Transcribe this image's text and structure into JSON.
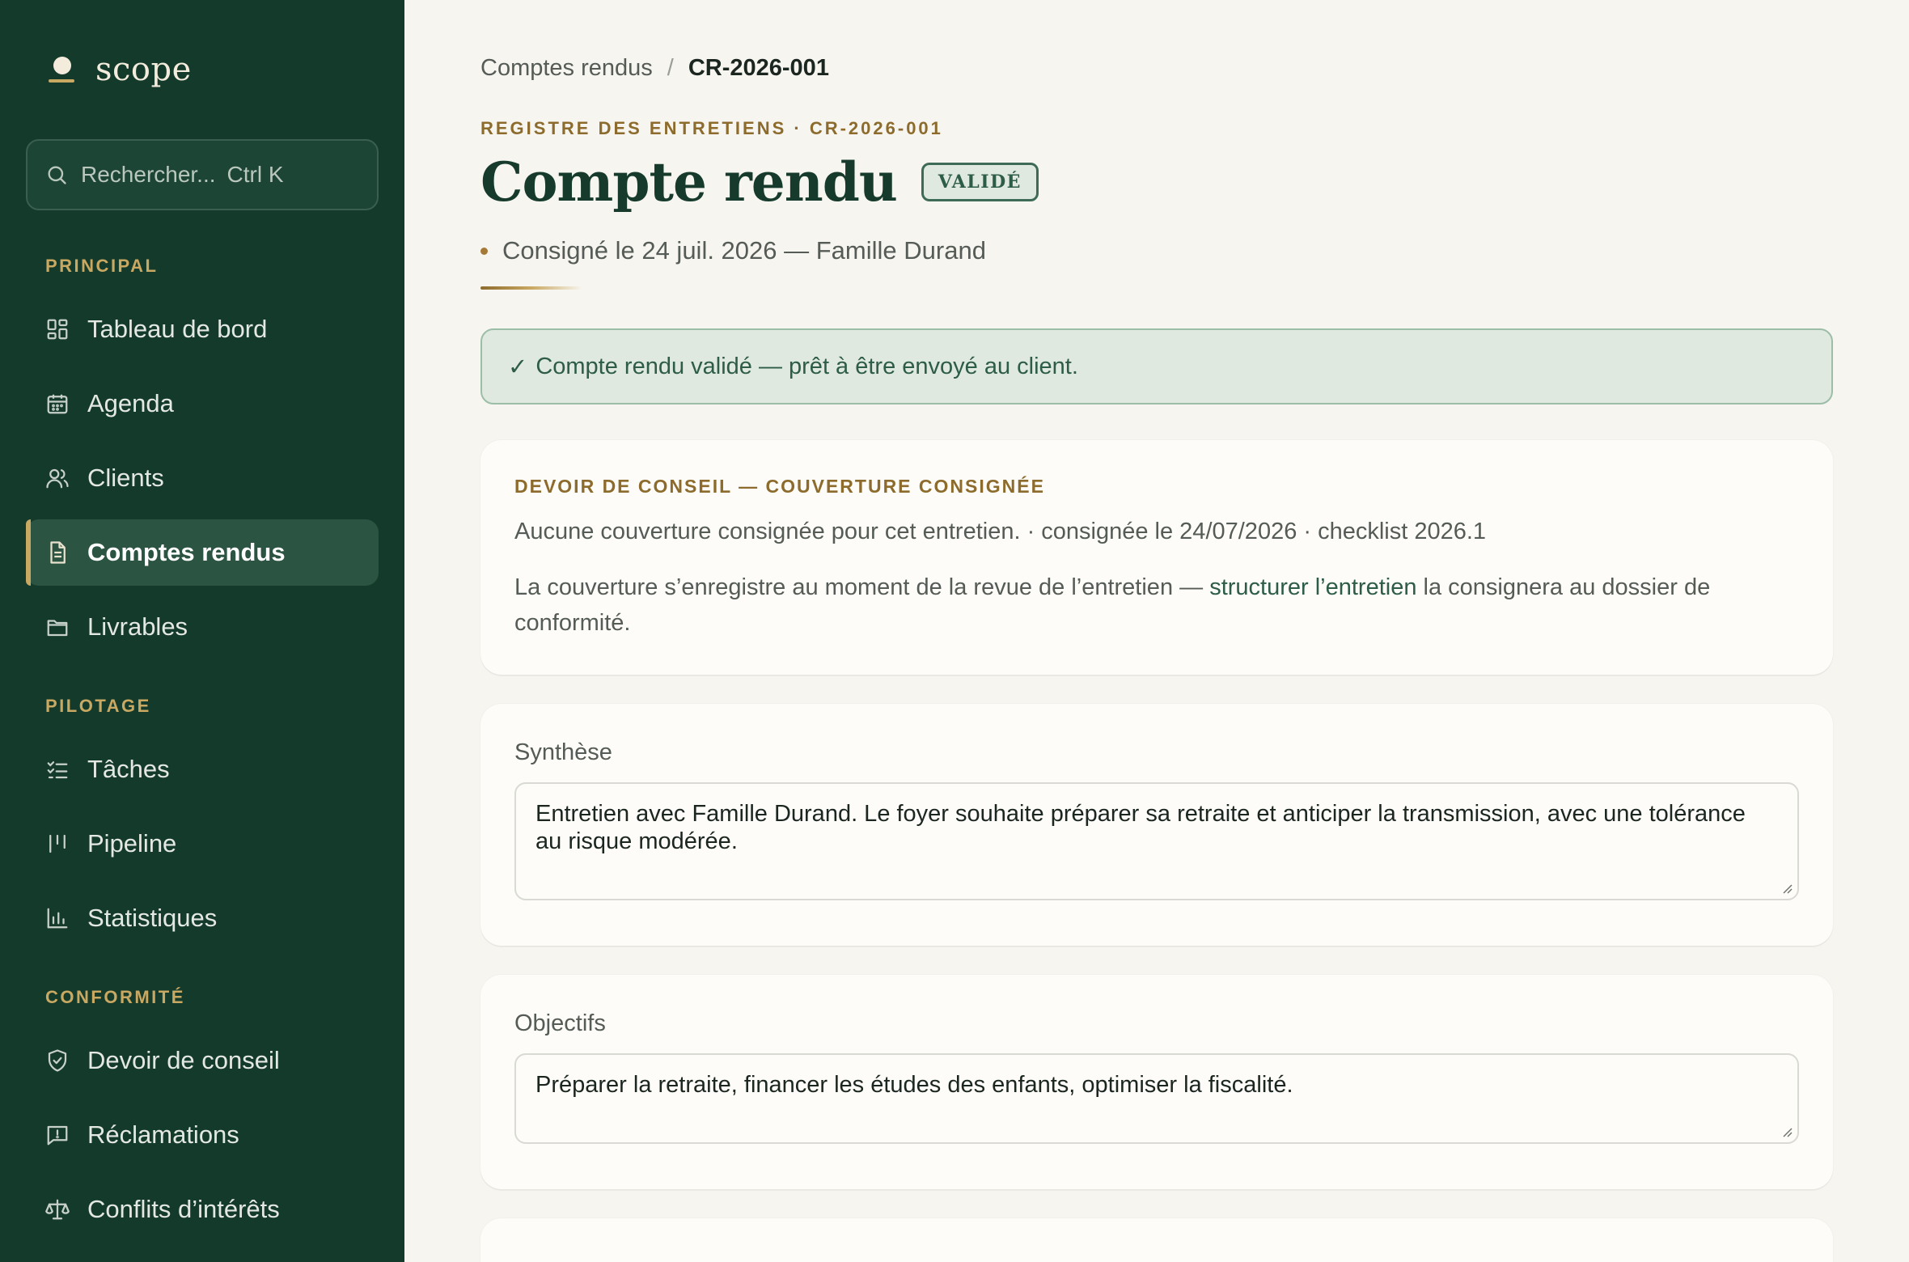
{
  "brand": {
    "name": "scope"
  },
  "search": {
    "placeholder": "Rechercher...",
    "shortcut": "Ctrl K"
  },
  "sidebar": {
    "sections": [
      {
        "label": "PRINCIPAL",
        "items": [
          {
            "label": "Tableau de bord",
            "icon": "dashboard-icon"
          },
          {
            "label": "Agenda",
            "icon": "calendar-icon"
          },
          {
            "label": "Clients",
            "icon": "users-icon"
          },
          {
            "label": "Comptes rendus",
            "icon": "document-icon",
            "active": true
          },
          {
            "label": "Livrables",
            "icon": "folder-icon"
          }
        ]
      },
      {
        "label": "PILOTAGE",
        "items": [
          {
            "label": "Tâches",
            "icon": "checklist-icon"
          },
          {
            "label": "Pipeline",
            "icon": "pipeline-icon"
          },
          {
            "label": "Statistiques",
            "icon": "bar-chart-icon"
          }
        ]
      },
      {
        "label": "CONFORMITÉ",
        "items": [
          {
            "label": "Devoir de conseil",
            "icon": "shield-check-icon"
          },
          {
            "label": "Réclamations",
            "icon": "message-alert-icon"
          },
          {
            "label": "Conflits d’intérêts",
            "icon": "scale-icon"
          }
        ]
      }
    ]
  },
  "breadcrumb": {
    "parent": "Comptes rendus",
    "separator": "/",
    "current": "CR-2026-001"
  },
  "header": {
    "eyebrow": "REGISTRE DES ENTRETIENS · CR-2026-001",
    "title": "Compte rendu",
    "badge": "VALIDÉ",
    "meta": "Consigné le 24 juil. 2026 — Famille Durand"
  },
  "alert": {
    "check": "✓",
    "text": "Compte rendu validé — prêt à être envoyé au client."
  },
  "conseil": {
    "label": "DEVOIR DE CONSEIL — COUVERTURE CONSIGNÉE",
    "line": "Aucune couverture consignée pour cet entretien. · consignée le 24/07/2026 · checklist 2026.1",
    "para_before": "La couverture s’enregistre au moment de la revue de l’entretien — ",
    "para_link": "structurer l’entretien",
    "para_after": " la consignera au dossier de conformité."
  },
  "synthese": {
    "label": "Synthèse",
    "value": "Entretien avec Famille Durand. Le foyer souhaite préparer sa retraite et anticiper la transmission, avec une tolérance au risque modérée."
  },
  "objectifs": {
    "label": "Objectifs",
    "value": "Préparer la retraite, financer les études des enfants, optimiser la fiscalité."
  },
  "colors": {
    "sidebar": "#143a2c",
    "accent_gold": "#c9a862",
    "accent_green": "#2d5c47"
  }
}
